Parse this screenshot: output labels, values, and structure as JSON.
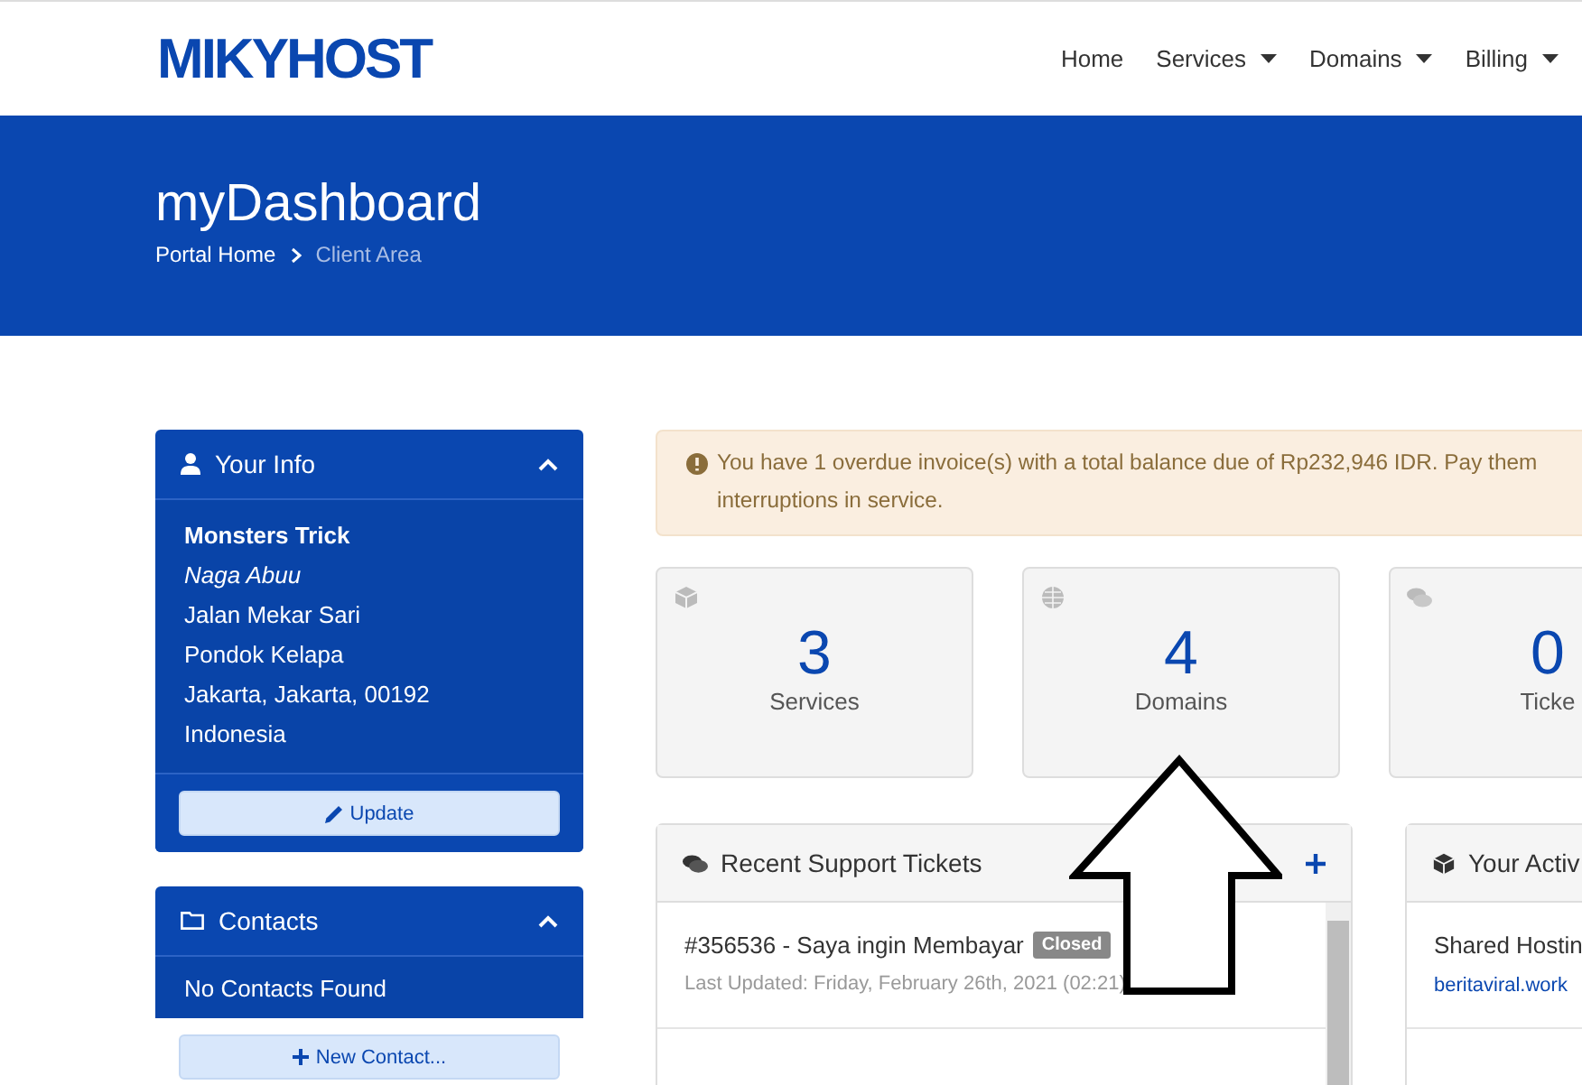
{
  "logo": "MIKYHOST",
  "nav": [
    {
      "label": "Home",
      "dropdown": false
    },
    {
      "label": "Services",
      "dropdown": true
    },
    {
      "label": "Domains",
      "dropdown": true
    },
    {
      "label": "Billing",
      "dropdown": true
    }
  ],
  "banner": {
    "title": "myDashboard",
    "breadcrumb": [
      {
        "label": "Portal Home",
        "current": false
      },
      {
        "label": "Client Area",
        "current": true
      }
    ]
  },
  "your_info": {
    "title": "Your Info",
    "expanded": true,
    "name": "Monsters Trick",
    "company": "Naga Abuu",
    "address": [
      "Jalan Mekar Sari",
      "Pondok Kelapa",
      "Jakarta, Jakarta, 00192",
      "Indonesia"
    ],
    "button": "Update"
  },
  "contacts": {
    "title": "Contacts",
    "expanded": true,
    "empty_text": "No Contacts Found",
    "button": "New Contact..."
  },
  "alert": {
    "text": "You have 1 overdue invoice(s) with a total balance due of Rp232,946 IDR. Pay them",
    "text_2": "interruptions in service."
  },
  "stats": [
    {
      "kind": "box",
      "count": "3",
      "label": "Services"
    },
    {
      "kind": "globe",
      "count": "4",
      "label": "Domains"
    },
    {
      "kind": "comments",
      "count": "0",
      "label": "Ticke"
    }
  ],
  "tickets": {
    "title": "Recent Support Tickets",
    "items": [
      {
        "subject": "#356536 - Saya ingin Membayar",
        "status": "Closed",
        "updated": "Last Updated: Friday, February 26th, 2021 (02:21)"
      }
    ]
  },
  "activity": {
    "title": "Your Activ",
    "items": [
      {
        "name": "Shared Hostin",
        "domain": "beritaviral.work"
      }
    ]
  }
}
